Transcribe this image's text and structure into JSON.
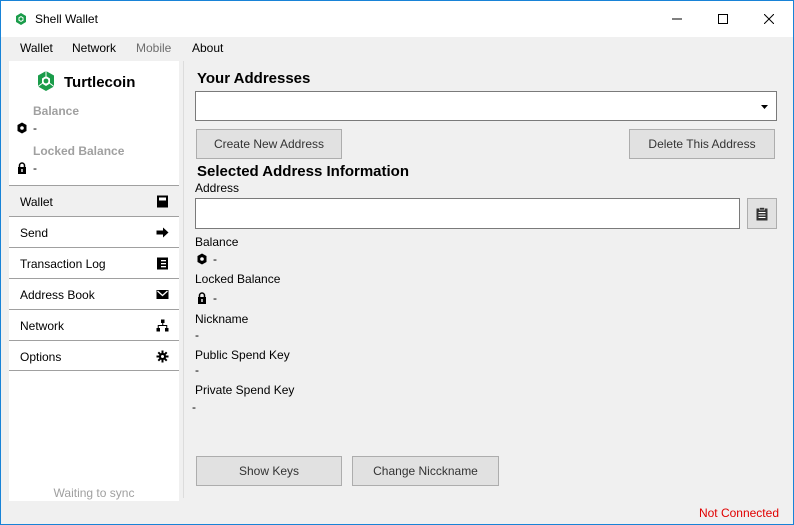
{
  "window": {
    "title": "Shell Wallet",
    "icon": "turtle-shell-icon",
    "controls": [
      "minimize-icon",
      "maximize-icon",
      "close-icon"
    ]
  },
  "menu": {
    "items": [
      {
        "label": "Wallet",
        "enabled": true
      },
      {
        "label": "Network",
        "enabled": true
      },
      {
        "label": "Mobile",
        "enabled": false
      },
      {
        "label": "About",
        "enabled": true
      }
    ]
  },
  "sidebar": {
    "brand": "Turtlecoin",
    "balance_label": "Balance",
    "balance_value": "-",
    "locked_label": "Locked Balance",
    "locked_value": "-",
    "nav": [
      {
        "label": "Wallet",
        "icon": "calculator-icon",
        "active": true
      },
      {
        "label": "Send",
        "icon": "arrow-right-icon",
        "active": false
      },
      {
        "label": "Transaction Log",
        "icon": "ledger-icon",
        "active": false
      },
      {
        "label": "Address Book",
        "icon": "envelope-icon",
        "active": false
      },
      {
        "label": "Network",
        "icon": "network-icon",
        "active": false
      },
      {
        "label": "Options",
        "icon": "gear-icon",
        "active": false
      }
    ],
    "sync_text": "Waiting to sync",
    "sync_progress": 0
  },
  "main": {
    "addresses_title": "Your Addresses",
    "address_select_value": "",
    "create_button": "Create New Address",
    "delete_button": "Delete This Address",
    "info_title": "Selected Address Information",
    "address_label": "Address",
    "address_value": "",
    "balance_label": "Balance",
    "balance_value": "-",
    "locked_label": "Locked Balance",
    "locked_value": "-",
    "nickname_label": "Nickname",
    "nickname_value": "-",
    "public_key_label": "Public Spend Key",
    "public_key_value": "-",
    "private_key_label": "Private Spend Key",
    "private_key_value": "-",
    "show_keys_button": "Show Keys",
    "change_nickname_button": "Change Niccknаme"
  },
  "status": {
    "text": "Not Connected",
    "color": "#e00000"
  },
  "colors": {
    "brand_green": "#1a9c4a",
    "window_border": "#1883d7"
  }
}
